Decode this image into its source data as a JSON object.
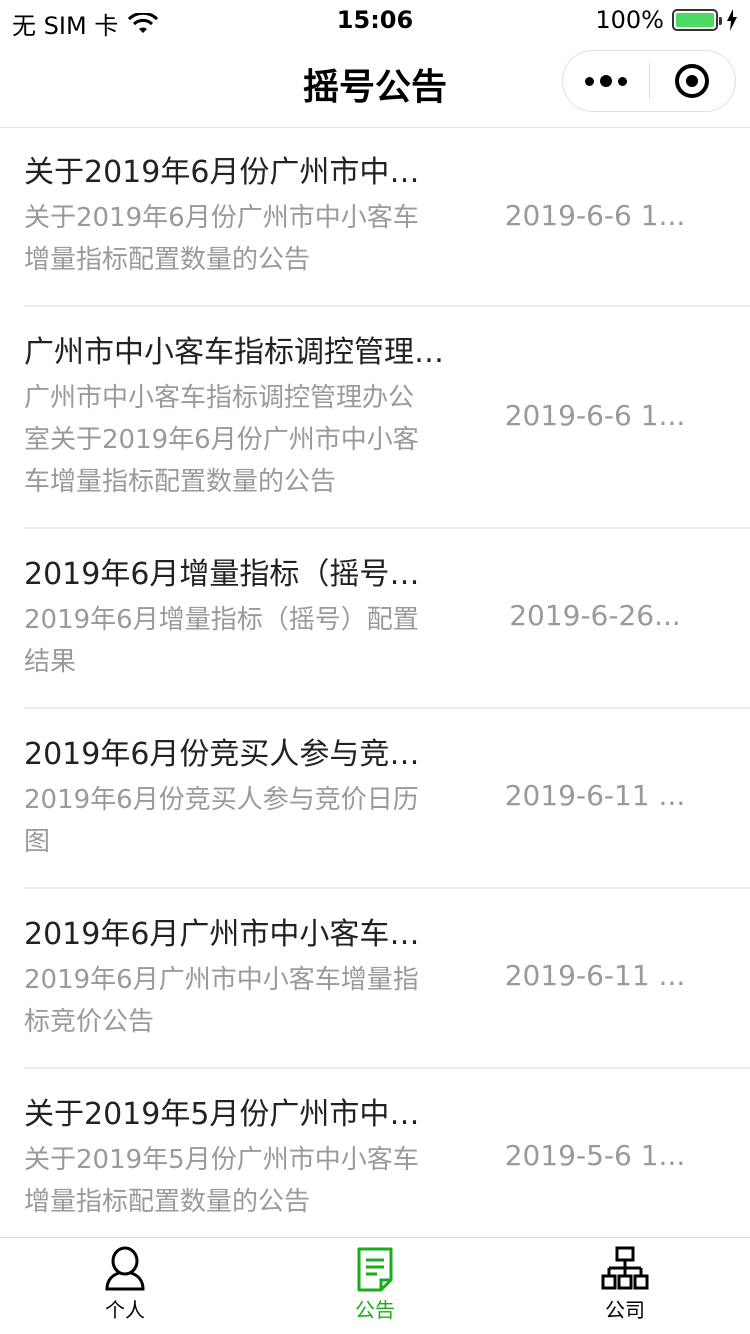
{
  "status_bar": {
    "carrier": "无 SIM 卡",
    "time": "15:06",
    "battery_percent": "100%",
    "battery_level": 1.0
  },
  "nav": {
    "title": "摇号公告",
    "more_icon": "more-dots-icon",
    "close_icon": "target-circle-icon"
  },
  "announcements": [
    {
      "title": "关于2019年6月份广州市中小客车增量指标配置数量的公告",
      "summary_lines": [
        "关于2019年6月份广州市中小客车",
        "增量指标配置数量的公告"
      ],
      "date": "2019-6-6 1..."
    },
    {
      "title": "广州市中小客车指标调控管理办公室关于2019年6月份广州市中小客车增量指标配置数量的公告",
      "summary_lines": [
        "广州市中小客车指标调控管理办公",
        "室关于2019年6月份广州市中小客",
        "车增量指标配置数量的公告"
      ],
      "date": "2019-6-6 1..."
    },
    {
      "title": "2019年6月增量指标（摇号）配置结果",
      "summary_lines": [
        "2019年6月增量指标（摇号）配置",
        "结果"
      ],
      "date": "2019-6-26..."
    },
    {
      "title": "2019年6月份竞买人参与竞价日历图",
      "summary_lines": [
        "2019年6月份竞买人参与竞价日历",
        "图"
      ],
      "date": "2019-6-11 ..."
    },
    {
      "title": "2019年6月广州市中小客车增量指标竞价公告",
      "summary_lines": [
        "2019年6月广州市中小客车增量指",
        "标竞价公告"
      ],
      "date": "2019-6-11 ..."
    },
    {
      "title": "关于2019年5月份广州市中小客车增量指标配置数量的公告",
      "summary_lines": [
        "关于2019年5月份广州市中小客车",
        "增量指标配置数量的公告"
      ],
      "date": "2019-5-6 1..."
    }
  ],
  "tabs": [
    {
      "label": "个人",
      "icon": "person-icon",
      "active": false
    },
    {
      "label": "公告",
      "icon": "document-icon",
      "active": true
    },
    {
      "label": "公司",
      "icon": "org-chart-icon",
      "active": false
    }
  ],
  "colors": {
    "accent": "#1aad19",
    "title_text": "#222222",
    "secondary_text": "#9a9a9a",
    "battery_fill": "#4cd964"
  }
}
